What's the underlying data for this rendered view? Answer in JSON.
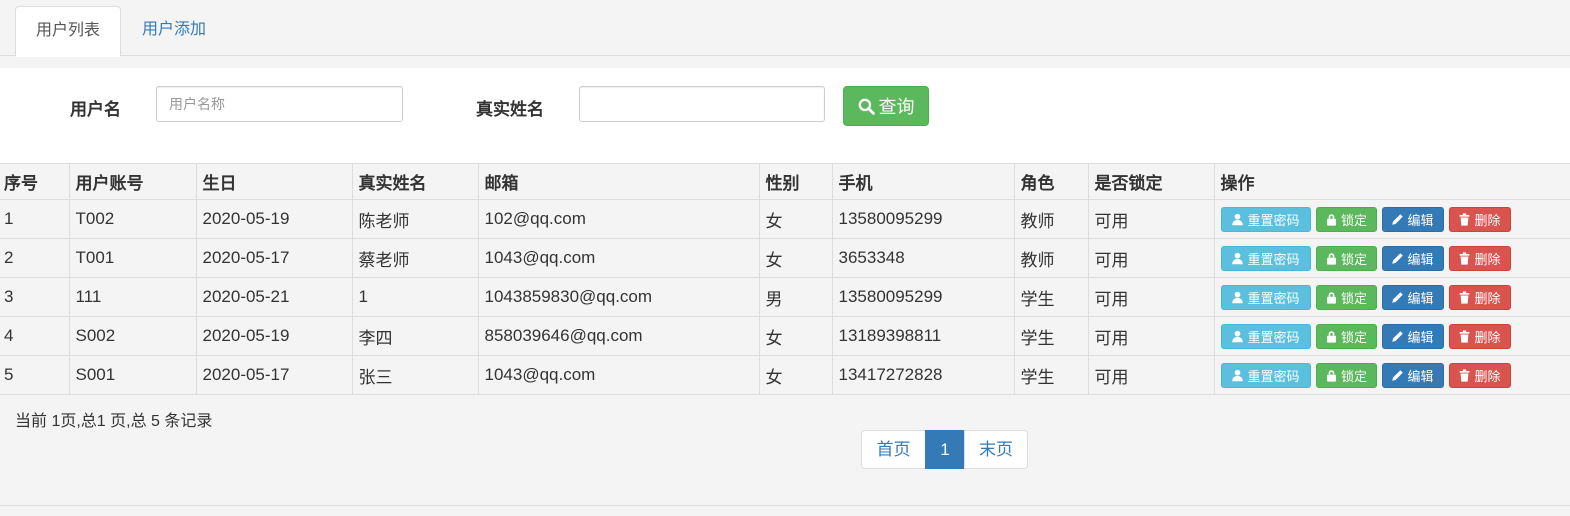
{
  "tabs": [
    {
      "label": "用户列表",
      "active": true
    },
    {
      "label": "用户添加",
      "active": false
    }
  ],
  "search": {
    "username_label": "用户名",
    "username_placeholder": "用户名称",
    "username_value": "",
    "realname_label": "真实姓名",
    "realname_value": "",
    "query_label": "查询"
  },
  "table": {
    "columns": [
      "序号",
      "用户账号",
      "生日",
      "真实姓名",
      "邮箱",
      "性别",
      "手机",
      "角色",
      "是否锁定",
      "操作"
    ],
    "rows": [
      {
        "no": "1",
        "account": "T002",
        "birthday": "2020-05-19",
        "realname": "陈老师",
        "email": "102@qq.com",
        "gender": "女",
        "phone": "13580095299",
        "role": "教师",
        "locked": "可用"
      },
      {
        "no": "2",
        "account": "T001",
        "birthday": "2020-05-17",
        "realname": "蔡老师",
        "email": "1043@qq.com",
        "gender": "女",
        "phone": "3653348",
        "role": "教师",
        "locked": "可用"
      },
      {
        "no": "3",
        "account": "111",
        "birthday": "2020-05-21",
        "realname": "1",
        "email": "1043859830@qq.com",
        "gender": "男",
        "phone": "13580095299",
        "role": "学生",
        "locked": "可用"
      },
      {
        "no": "4",
        "account": "S002",
        "birthday": "2020-05-19",
        "realname": "李四",
        "email": "858039646@qq.com",
        "gender": "女",
        "phone": "13189398811",
        "role": "学生",
        "locked": "可用"
      },
      {
        "no": "5",
        "account": "S001",
        "birthday": "2020-05-17",
        "realname": "张三",
        "email": "1043@qq.com",
        "gender": "女",
        "phone": "13417272828",
        "role": "学生",
        "locked": "可用"
      }
    ],
    "actions": {
      "reset_password": "重置密码",
      "lock": "锁定",
      "edit": "编辑",
      "delete": "删除"
    }
  },
  "pagination": {
    "summary": "当前 1页,总1 页,总 5 条记录",
    "first": "首页",
    "current": "1",
    "last": "末页"
  },
  "colors": {
    "primary": "#337ab7",
    "success": "#5cb85c",
    "info": "#5bc0de",
    "danger": "#d9534f"
  },
  "icons": {
    "search": "search-icon",
    "reset_password": "user-icon",
    "lock": "lock-icon",
    "edit": "pencil-icon",
    "delete": "trash-icon"
  }
}
